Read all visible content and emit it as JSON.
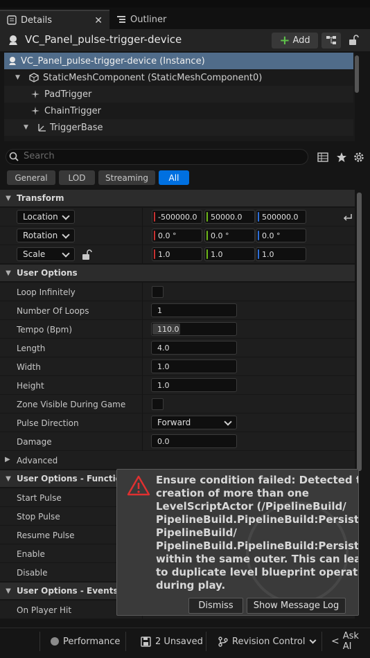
{
  "tabs": [
    {
      "label": "Details",
      "close": "✕"
    },
    {
      "label": "Outliner"
    }
  ],
  "header": {
    "actor_name": "VC_Panel_pulse-trigger-device",
    "add_label": "Add"
  },
  "tree": [
    {
      "label": "VC_Panel_pulse-trigger-device (Instance)",
      "selected": true
    },
    {
      "label": "StaticMeshComponent (StaticMeshComponent0)"
    },
    {
      "label": "PadTrigger"
    },
    {
      "label": "ChainTrigger"
    },
    {
      "label": "TriggerBase"
    }
  ],
  "search": {
    "placeholder": "Search"
  },
  "filters": [
    "General",
    "LOD",
    "Streaming",
    "All"
  ],
  "active_filter": "All",
  "transform": {
    "title": "Transform",
    "location": {
      "label": "Location",
      "x": "-500000.0",
      "y": "50000.0",
      "z": "500000.0"
    },
    "rotation": {
      "label": "Rotation",
      "x": "0.0 °",
      "y": "0.0 °",
      "z": "0.0 °"
    },
    "scale": {
      "label": "Scale",
      "x": "1.0",
      "y": "1.0",
      "z": "1.0"
    }
  },
  "user_options": {
    "title": "User Options",
    "rows": [
      {
        "label": "Loop Infinitely",
        "type": "checkbox",
        "checked": false
      },
      {
        "label": "Number Of Loops",
        "type": "number",
        "value": "1"
      },
      {
        "label": "Tempo (Bpm)",
        "type": "slider",
        "value": "110.0",
        "fill": 0.33
      },
      {
        "label": "Length",
        "type": "number",
        "value": "4.0"
      },
      {
        "label": "Width",
        "type": "number",
        "value": "1.0"
      },
      {
        "label": "Height",
        "type": "number",
        "value": "1.0"
      },
      {
        "label": "Zone Visible During Game",
        "type": "checkbox",
        "checked": false
      },
      {
        "label": "Pulse Direction",
        "type": "select",
        "value": "Forward"
      },
      {
        "label": "Damage",
        "type": "number",
        "value": "0.0"
      }
    ],
    "advanced": "Advanced"
  },
  "functions": {
    "title": "User Options - Functions",
    "rows": [
      "Start Pulse",
      "Stop Pulse",
      "Resume Pulse",
      "Enable",
      "Disable"
    ]
  },
  "events": {
    "title": "User Options - Events",
    "rows": [
      "On Player Hit"
    ]
  },
  "toast": {
    "lines": [
      "Ensure condition failed: Detected the",
      "creation of more than one",
      "LevelScriptActor (/PipelineBuild/",
      "PipelineBuild.PipelineBuild:PersistentLe",
      "PipelineBuild/",
      "PipelineBuild.PipelineBuild:PersistentLe",
      "within the same outer. This can lead",
      "to duplicate level blueprint operations",
      "during play."
    ],
    "dismiss": "Dismiss",
    "show_log": "Show Message Log"
  },
  "statusbar": {
    "performance": "Performance",
    "unsaved": "2 Unsaved",
    "revision": "Revision Control",
    "ask": "Ask AI"
  },
  "colors": {
    "accent": "#0070e0",
    "selection": "#506c8a",
    "x_axis": "#c83232",
    "y_axis": "#6fb81a",
    "z_axis": "#2e6fd8",
    "warning": "#e03030"
  }
}
